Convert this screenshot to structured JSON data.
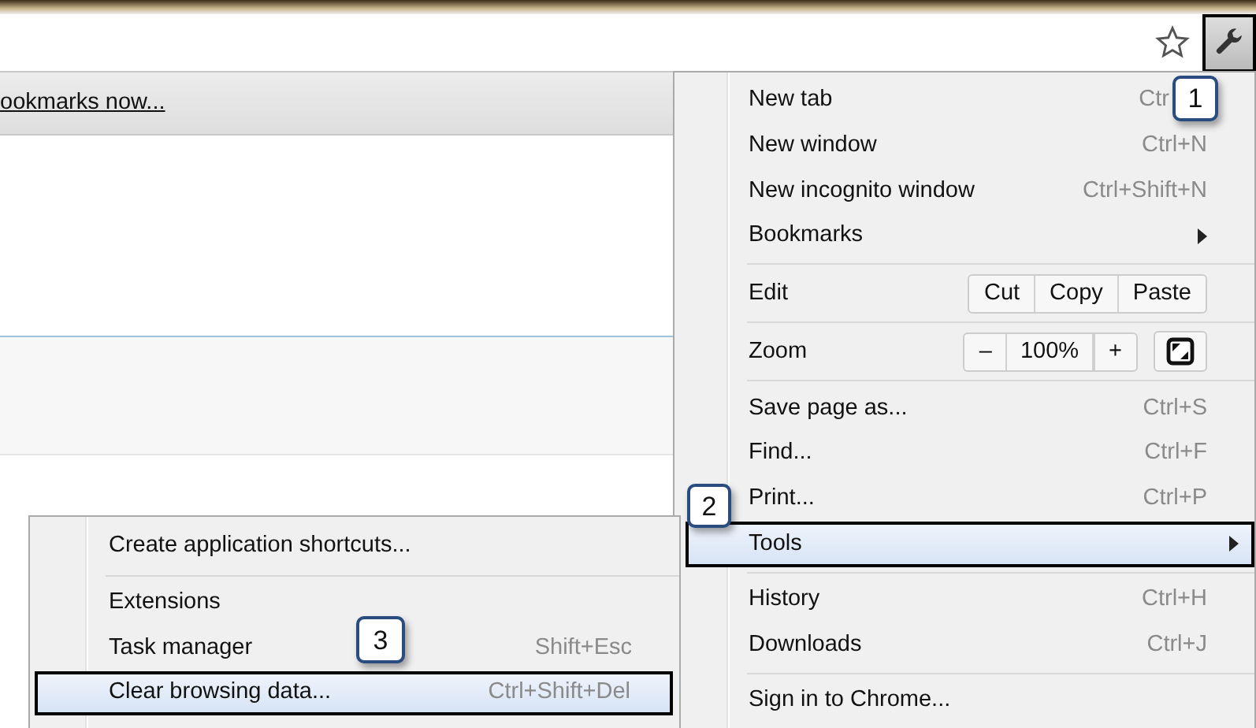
{
  "toolbar": {
    "wrench_highlighted": true
  },
  "bookmarks_bar": {
    "link": "ookmarks now..."
  },
  "menu": {
    "items": [
      {
        "kind": "item",
        "label": "New tab",
        "shortcut": "Ctr",
        "submenu": false,
        "highlighted": false
      },
      {
        "kind": "item",
        "label": "New window",
        "shortcut": "Ctrl+N",
        "submenu": false,
        "highlighted": false
      },
      {
        "kind": "item",
        "label": "New incognito window",
        "shortcut": "Ctrl+Shift+N",
        "submenu": false,
        "highlighted": false
      },
      {
        "kind": "item",
        "label": "Bookmarks",
        "submenu": true,
        "highlighted": false
      },
      {
        "kind": "separator"
      },
      {
        "kind": "edit",
        "label": "Edit",
        "buttons": [
          "Cut",
          "Copy",
          "Paste"
        ]
      },
      {
        "kind": "separator"
      },
      {
        "kind": "zoom",
        "label": "Zoom",
        "minus": "–",
        "value": "100%",
        "plus": "+"
      },
      {
        "kind": "separator"
      },
      {
        "kind": "item",
        "label": "Save page as...",
        "shortcut": "Ctrl+S",
        "submenu": false,
        "highlighted": false
      },
      {
        "kind": "item",
        "label": "Find...",
        "shortcut": "Ctrl+F",
        "submenu": false,
        "highlighted": false
      },
      {
        "kind": "item",
        "label": "Print...",
        "shortcut": "Ctrl+P",
        "submenu": false,
        "highlighted": false
      },
      {
        "kind": "item",
        "label": "Tools",
        "submenu": true,
        "highlighted": true
      },
      {
        "kind": "separator"
      },
      {
        "kind": "item",
        "label": "History",
        "shortcut": "Ctrl+H",
        "submenu": false,
        "highlighted": false
      },
      {
        "kind": "item",
        "label": "Downloads",
        "shortcut": "Ctrl+J",
        "submenu": false,
        "highlighted": false
      },
      {
        "kind": "separator"
      },
      {
        "kind": "item",
        "label": "Sign in to Chrome...",
        "submenu": false,
        "highlighted": false
      }
    ]
  },
  "submenu": {
    "items": [
      {
        "kind": "item",
        "label": "Create application shortcuts...",
        "highlighted": false
      },
      {
        "kind": "separator"
      },
      {
        "kind": "item",
        "label": "Extensions",
        "highlighted": false
      },
      {
        "kind": "item",
        "label": "Task manager",
        "shortcut": "Shift+Esc",
        "highlighted": false
      },
      {
        "kind": "item",
        "label": "Clear browsing data...",
        "shortcut": "Ctrl+Shift+Del",
        "highlighted": true
      }
    ]
  },
  "callouts": [
    {
      "label": "1"
    },
    {
      "label": "2"
    },
    {
      "label": "3"
    }
  ]
}
